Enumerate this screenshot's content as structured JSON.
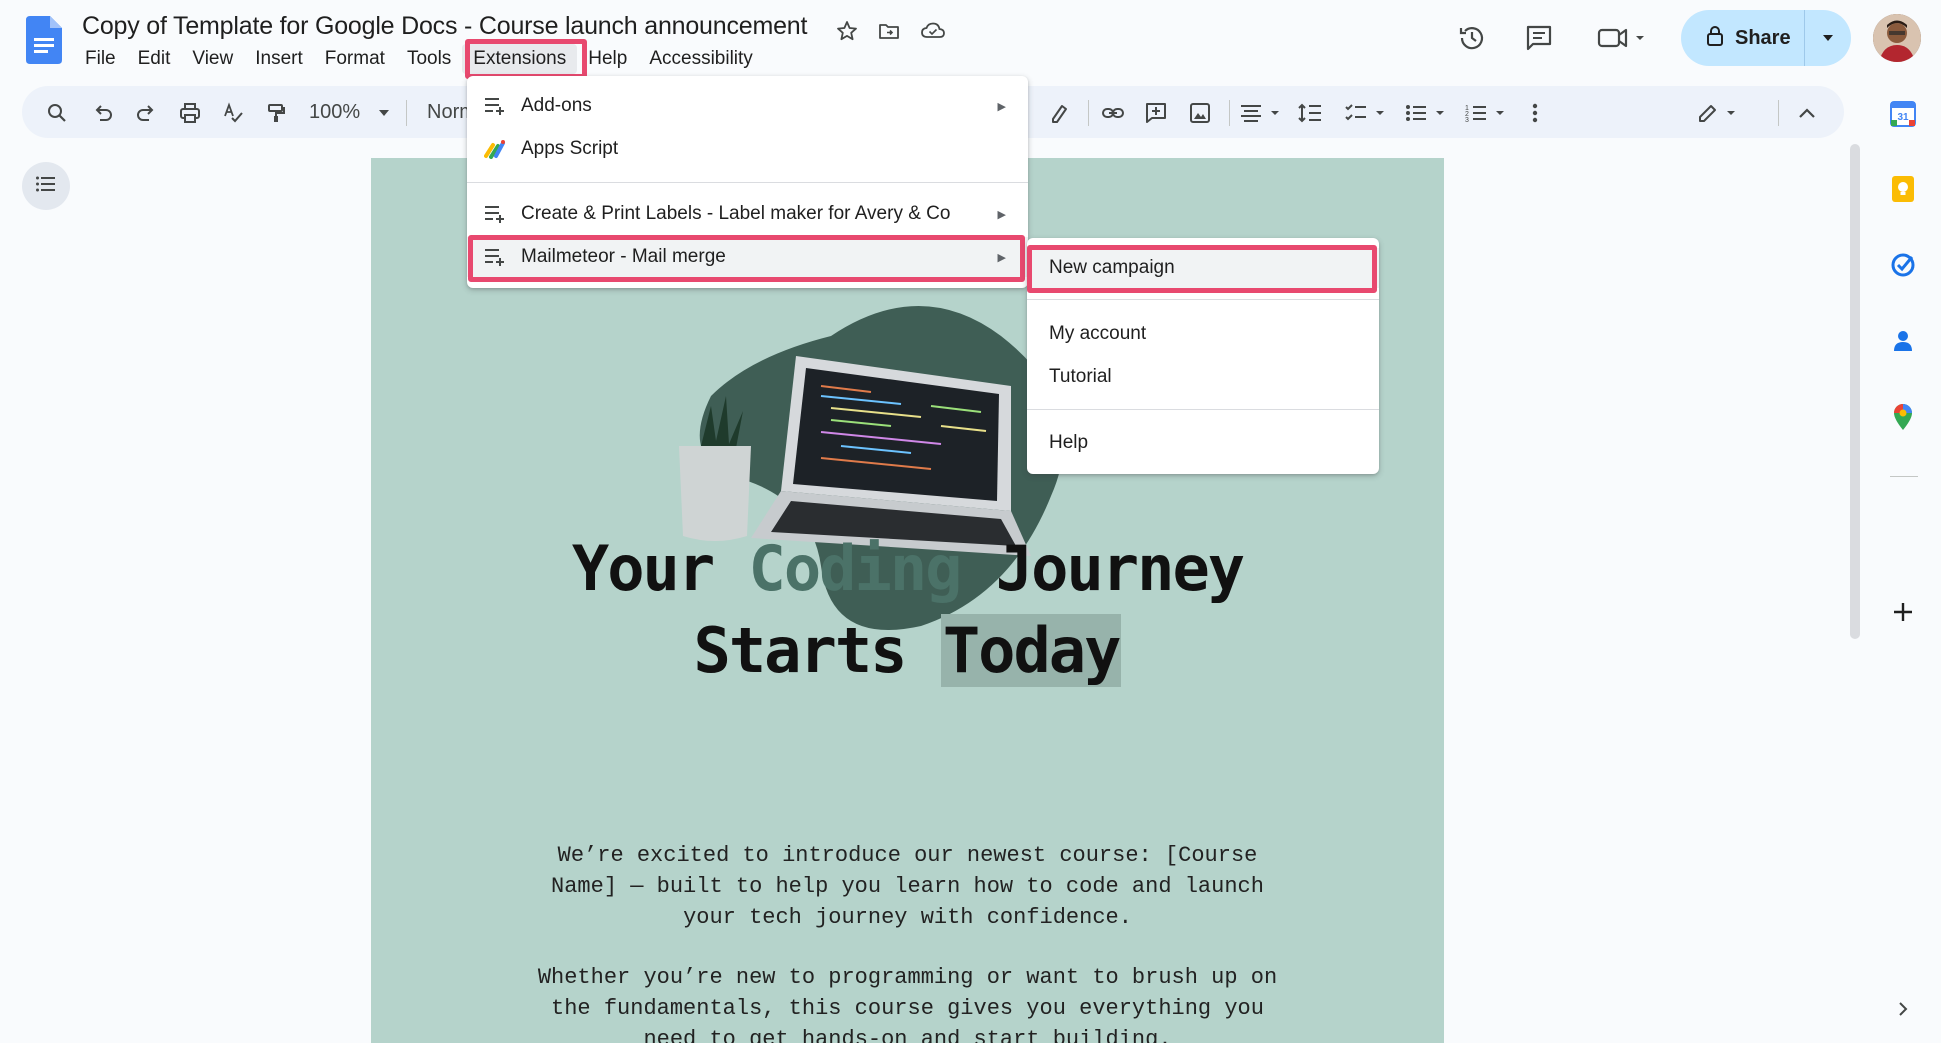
{
  "document": {
    "title": "Copy of Template for Google Docs - Course launch announcement"
  },
  "menubar": [
    "File",
    "Edit",
    "View",
    "Insert",
    "Format",
    "Tools",
    "Extensions",
    "Help",
    "Accessibility"
  ],
  "header": {
    "share_label": "Share",
    "icons": [
      "star-icon",
      "move-folder-icon",
      "cloud-status-icon",
      "version-history-icon",
      "comments-icon",
      "meet-icon",
      "lock-icon",
      "avatar"
    ]
  },
  "toolbar": {
    "zoom": "100%",
    "style_partial": "Norm",
    "icons": [
      "search-icon",
      "undo-icon",
      "redo-icon",
      "print-icon",
      "spellcheck-icon",
      "paint-format-icon",
      "highlight-icon",
      "link-icon",
      "add-comment-icon",
      "image-icon",
      "align-icon",
      "line-spacing-icon",
      "checklist-icon",
      "bullet-list-icon",
      "numbered-list-icon",
      "more-icon",
      "editing-mode-icon",
      "collapse-icon"
    ]
  },
  "extensions_menu": {
    "items": [
      {
        "label": "Add-ons",
        "icon": "addons-icon",
        "has_submenu": true
      },
      {
        "label": "Apps Script",
        "icon": "apps-script-icon",
        "has_submenu": false
      },
      {
        "label": "Create & Print Labels - Label maker for Avery & Co",
        "icon": "addon-list-icon",
        "has_submenu": true
      },
      {
        "label": "Mailmeteor - Mail merge",
        "icon": "addon-list-icon",
        "has_submenu": true
      }
    ]
  },
  "mailmeteor_submenu": {
    "items": [
      "New campaign",
      "My account",
      "Tutorial",
      "Help"
    ]
  },
  "page": {
    "heading_line1_a": "Your ",
    "heading_line1_accent": "Coding",
    "heading_line1_b": " Journey",
    "heading_line2_a": "Starts ",
    "heading_line2_sel": "Today",
    "para1": [
      "We’re excited to introduce our newest course: [Course",
      "Name] — built to help you learn how to code and launch",
      "your tech journey with confidence."
    ],
    "para2": [
      "Whether you’re new to programming or want to brush up on",
      "the fundamentals, this course gives you everything you",
      "need to get hands-on and start building."
    ]
  },
  "side_panel": {
    "icons": [
      "calendar-icon",
      "keep-icon",
      "tasks-icon",
      "contacts-icon",
      "maps-icon",
      "add-icon",
      "expand-panel-icon"
    ],
    "calendar_day": "31"
  },
  "colors": {
    "highlight_box": "#e8496f",
    "page_background": "#b5d3cb",
    "accent_text": "#4b7268",
    "share_button": "#c2e7ff"
  }
}
